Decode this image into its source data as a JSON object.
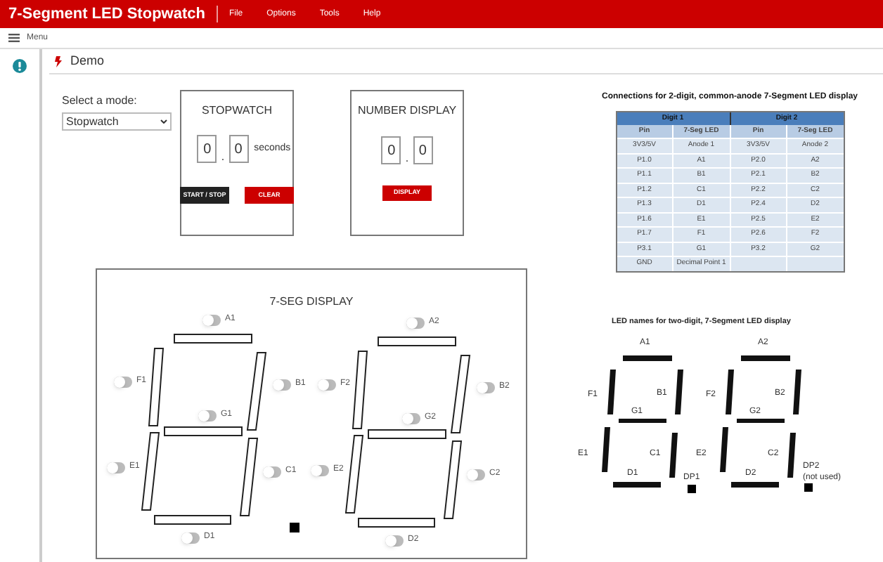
{
  "app": {
    "title": "7-Segment LED Stopwatch",
    "menus": [
      "File",
      "Options",
      "Tools",
      "Help"
    ]
  },
  "menu_bar": {
    "label": "Menu"
  },
  "page": {
    "title": "Demo"
  },
  "mode": {
    "label": "Select a mode:",
    "value": "Stopwatch"
  },
  "stopwatch": {
    "title": "STOPWATCH",
    "digits": [
      "0",
      "0"
    ],
    "separator": ".",
    "unit": "seconds",
    "buttons": [
      {
        "label": "START / STOP",
        "kind": "dark"
      },
      {
        "label": "CLEAR",
        "kind": "red"
      }
    ]
  },
  "number_display": {
    "title": "NUMBER DISPLAY",
    "digits": [
      "0",
      "0"
    ],
    "separator": ".",
    "button": "DISPLAY"
  },
  "display": {
    "title": "7-SEG DISPLAY",
    "digits": [
      {
        "segments": [
          {
            "label": "A1",
            "on": false
          },
          {
            "label": "B1",
            "on": false
          },
          {
            "label": "C1",
            "on": false
          },
          {
            "label": "D1",
            "on": false
          },
          {
            "label": "E1",
            "on": false
          },
          {
            "label": "F1",
            "on": false
          },
          {
            "label": "G1",
            "on": false
          }
        ]
      },
      {
        "segments": [
          {
            "label": "A2",
            "on": false
          },
          {
            "label": "B2",
            "on": false
          },
          {
            "label": "C2",
            "on": false
          },
          {
            "label": "D2",
            "on": false
          },
          {
            "label": "E2",
            "on": false
          },
          {
            "label": "F2",
            "on": false
          },
          {
            "label": "G2",
            "on": false
          }
        ]
      }
    ]
  },
  "connections": {
    "title": "Connections for 2-digit, common-anode 7-Segment LED display",
    "groups": [
      "Digit 1",
      "Digit 2"
    ],
    "columns": [
      "Pin",
      "7-Seg LED",
      "Pin",
      "7-Seg LED"
    ],
    "rows": [
      [
        "3V3/5V",
        "Anode 1",
        "3V3/5V",
        "Anode 2"
      ],
      [
        "P1.0",
        "A1",
        "P2.0",
        "A2"
      ],
      [
        "P1.1",
        "B1",
        "P2.1",
        "B2"
      ],
      [
        "P1.2",
        "C1",
        "P2.2",
        "C2"
      ],
      [
        "P1.3",
        "D1",
        "P2.4",
        "D2"
      ],
      [
        "P1.6",
        "E1",
        "P2.5",
        "E2"
      ],
      [
        "P1.7",
        "F1",
        "P2.6",
        "F2"
      ],
      [
        "P3.1",
        "G1",
        "P3.2",
        "G2"
      ],
      [
        "GND",
        "Decimal Point 1"
      ]
    ]
  },
  "led_names": {
    "title": "LED names for two-digit, 7-Segment LED display",
    "digits": [
      {
        "labels": [
          "A1",
          "B1",
          "C1",
          "D1",
          "E1",
          "F1",
          "G1"
        ],
        "dp": "DP1"
      },
      {
        "labels": [
          "A2",
          "B2",
          "C2",
          "D2",
          "E2",
          "F2",
          "G2"
        ],
        "dp": "DP2",
        "dp_note": "(not used)"
      }
    ]
  }
}
